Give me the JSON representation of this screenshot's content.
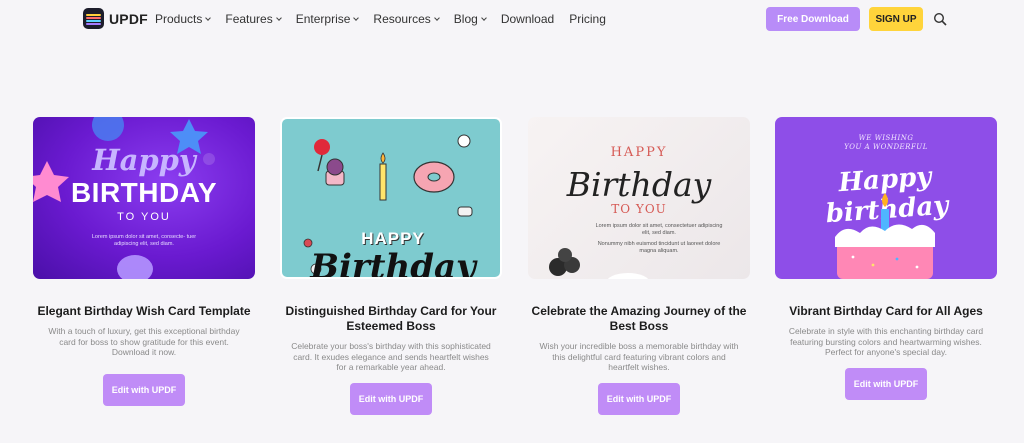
{
  "nav": {
    "brand": "UPDF",
    "menu": [
      {
        "label": "Products",
        "dropdown": true
      },
      {
        "label": "Features",
        "dropdown": true
      },
      {
        "label": "Enterprise",
        "dropdown": true
      },
      {
        "label": "Resources",
        "dropdown": true
      },
      {
        "label": "Blog",
        "dropdown": true
      },
      {
        "label": "Download",
        "dropdown": false
      },
      {
        "label": "Pricing",
        "dropdown": false
      }
    ],
    "free_download": "Free Download",
    "sign_up": "SIGN UP",
    "search_icon": "search-icon"
  },
  "colors": {
    "accent": "#b88cf8",
    "signup": "#ffd43b",
    "edit_button": "#c08cf7"
  },
  "cards": [
    {
      "title": "Elegant Birthday Wish Card Template",
      "description": "With a touch of luxury, get this exceptional birthday card for boss to show gratitude for this event. Download it now.",
      "button": "Edit with UPDF",
      "art": {
        "line1": "Happy",
        "line2": "BIRTHDAY",
        "line3": "TO YOU",
        "small": "Lorem ipsum dolor sit amet, consecte- tuer adipiscing elit, sed diam."
      }
    },
    {
      "title": "Distinguished Birthday Card for Your Esteemed Boss",
      "description": "Celebrate your boss's birthday with this sophisticated card. It exudes elegance and sends heartfelt wishes for a remarkable year ahead.",
      "button": "Edit with UPDF",
      "art": {
        "line1": "HAPPY",
        "line2": "Birthday"
      }
    },
    {
      "title": "Celebrate the Amazing Journey of the Best Boss",
      "description": "Wish your incredible boss a memorable birthday with this delightful card featuring vibrant colors and heartfelt wishes.",
      "button": "Edit with UPDF",
      "art": {
        "line1": "HAPPY",
        "line2": "Birthday",
        "line3": "TO YOU",
        "small1": "Lorem ipsum dolor sit amet, consectetuer adipiscing elit, sed diam.",
        "small2": "Nonummy nibh euismod tincidunt ut laoreet dolore magna aliquam."
      }
    },
    {
      "title": "Vibrant Birthday Card for All Ages",
      "description": "Celebrate in style with this enchanting birthday card featuring bursting colors and heartwarming wishes. Perfect for anyone's special day.",
      "button": "Edit with UPDF",
      "art": {
        "top1": "WE WISHING",
        "top2": "YOU A WONDERFUL",
        "line1": "Happy birthday"
      }
    }
  ]
}
